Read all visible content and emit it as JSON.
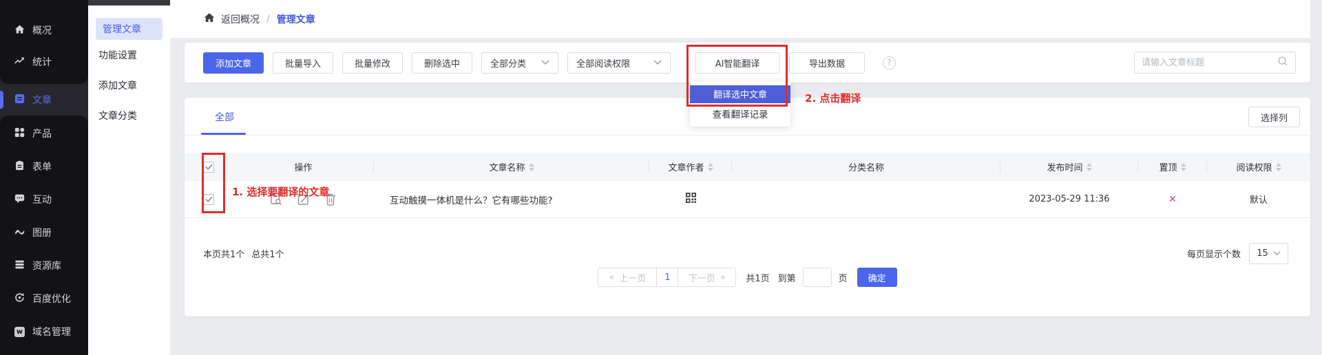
{
  "colors": {
    "accent": "#4b66e9",
    "menu_highlight": "#4c5fd7",
    "annotation_red": "#e12a2a",
    "cross_red": "#e8436a",
    "sidebar_dark": "#131317",
    "active_tab_blue": "#4558dd"
  },
  "sidebar": {
    "w_glyph": "w",
    "items": [
      {
        "label": "概况"
      },
      {
        "label": "统计"
      },
      {
        "label": "文章"
      },
      {
        "label": "产品"
      },
      {
        "label": "表单"
      },
      {
        "label": "互动"
      },
      {
        "label": "图册"
      },
      {
        "label": "资源库"
      },
      {
        "label": "百度优化"
      },
      {
        "label": "域名管理"
      }
    ]
  },
  "subsidebar": {
    "items": [
      {
        "label": "管理文章"
      },
      {
        "label": "功能设置"
      },
      {
        "label": "添加文章"
      },
      {
        "label": "文章分类"
      }
    ]
  },
  "breadcrumb": {
    "back": "返回概况",
    "separator": "/",
    "current": "管理文章"
  },
  "toolbar": {
    "add": "添加文章",
    "bulk_import": "批量导入",
    "bulk_edit": "批量修改",
    "delete_selected": "删除选中",
    "category_filter": "全部分类",
    "read_permission_filter": "全部阅读权限",
    "ai_translate": "AI智能翻译",
    "export": "导出数据",
    "help": "?",
    "search_placeholder": "请输入文章标题"
  },
  "ai_menu": {
    "translate_selected": "翻译选中文章",
    "view_records": "查看翻译记录"
  },
  "annotations": {
    "step1": "1. 选择要翻译的文章",
    "step2": "2. 点击翻译"
  },
  "tabs": {
    "all": "全部",
    "choose_columns": "选择列"
  },
  "table": {
    "headers": [
      {
        "label": "操作"
      },
      {
        "label": "文章名称"
      },
      {
        "label": "文章作者"
      },
      {
        "label": "分类名称"
      },
      {
        "label": "发布时间"
      },
      {
        "label": "置顶"
      },
      {
        "label": "阅读权限"
      }
    ],
    "row": {
      "title": "互动触摸一体机是什么？它有哪些功能?",
      "category": "",
      "publish_time": "2023-05-29 11:36",
      "pinned": "✕",
      "permission": "默认"
    }
  },
  "footer": {
    "page_count": "本页共1个",
    "total_count": "总共1个",
    "prev_arrow": "«",
    "prev": "上一页",
    "current_page": "1",
    "next": "下一页",
    "next_arrow": "»",
    "total_pages": "共1页",
    "goto_prefix": "到第",
    "goto_suffix": "页",
    "confirm": "确定",
    "per_page_label": "每页显示个数",
    "per_page_value": "15"
  }
}
